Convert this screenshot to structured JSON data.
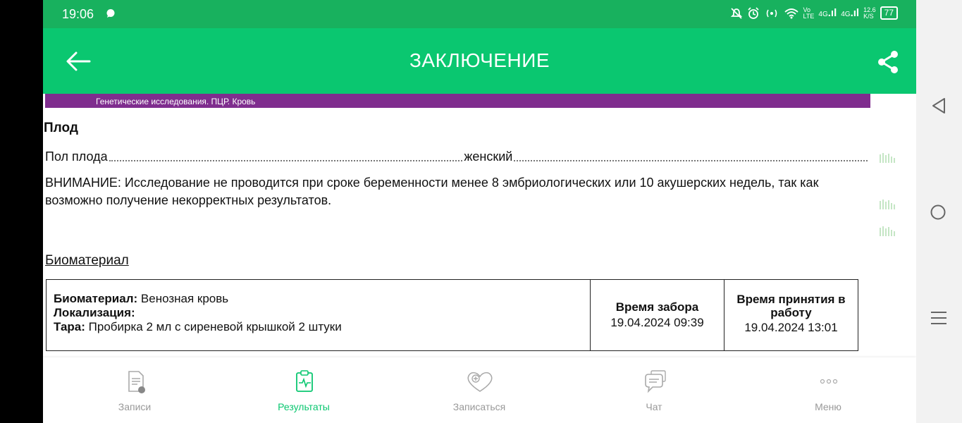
{
  "status": {
    "time": "19:06",
    "net_vo": "Vo",
    "net_lte": "LTE",
    "sig1": "4G",
    "sig2": "4G",
    "speed": "12.6",
    "speed_unit": "K/S",
    "battery": "77"
  },
  "appbar": {
    "title": "ЗАКЛЮЧЕНИЕ"
  },
  "content": {
    "category": "Генетические исследования. ПЦР. Кровь",
    "section_title": "Плод",
    "result": {
      "label": "Пол плода",
      "value": "женский"
    },
    "warning": "ВНИМАНИЕ: Исследование не проводится при сроке беременности менее 8 эмбриологических или 10 акушерских недель, так как возможно получение некорректных результатов.",
    "biomaterial_link": "Биоматериал",
    "biomaterial_table": {
      "biomaterial_label": "Биоматериал:",
      "biomaterial_value": "Венозная кровь",
      "localization_label": "Локализация:",
      "container_label": "Тара:",
      "container_value": "Пробирка 2 мл с сиреневой крышкой 2 штуки",
      "collection_header": "Время забора",
      "collection_value": "19.04.2024 09:39",
      "accept_header": "Время принятия в работу",
      "accept_value": "19.04.2024 13:01"
    }
  },
  "bottom_nav": [
    {
      "label": "Записи",
      "icon": "document-icon",
      "active": false
    },
    {
      "label": "Результаты",
      "icon": "clipboard-pulse-icon",
      "active": true
    },
    {
      "label": "Записаться",
      "icon": "heart-plus-icon",
      "active": false
    },
    {
      "label": "Чат",
      "icon": "chat-icon",
      "active": false
    },
    {
      "label": "Меню",
      "icon": "more-dots-icon",
      "active": false
    }
  ],
  "colors": {
    "statusbar": "#18b15e",
    "appbar": "#0ac770",
    "category_bar": "#7f2d8e",
    "active": "#0ac770",
    "inactive": "#999999"
  }
}
